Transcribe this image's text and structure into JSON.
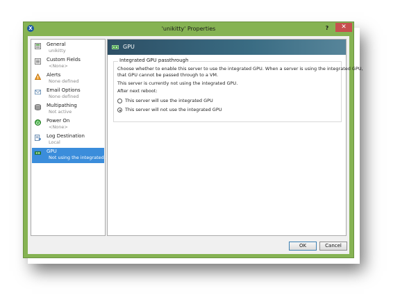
{
  "window": {
    "title": "'unikitty' Properties",
    "help_label": "?",
    "close_label": "✕",
    "app_icon": "xen-logo-icon"
  },
  "sidebar": {
    "items": [
      {
        "label": "General",
        "sub": "unikitty",
        "icon": "general-icon"
      },
      {
        "label": "Custom Fields",
        "sub": "<None>",
        "icon": "custom-fields-icon"
      },
      {
        "label": "Alerts",
        "sub": "None defined",
        "icon": "warning-icon"
      },
      {
        "label": "Email Options",
        "sub": "None defined",
        "icon": "email-icon"
      },
      {
        "label": "Multipathing",
        "sub": "Not active",
        "icon": "disk-icon"
      },
      {
        "label": "Power On",
        "sub": "<None>",
        "icon": "power-icon"
      },
      {
        "label": "Log Destination",
        "sub": "Local",
        "icon": "log-icon"
      },
      {
        "label": "GPU",
        "sub": "Not using the integrated...",
        "icon": "gpu-icon",
        "selected": true
      }
    ]
  },
  "main": {
    "banner_title": "GPU",
    "group_title": "Integrated GPU passthrough",
    "description_line1": "Choose whether to enable this server to use the integrated GPU. When a server is using the integrated GPU,",
    "description_line2": "that GPU cannot be passed through to a VM.",
    "status_text": "This server is currently not using the integrated GPU.",
    "after_reboot_label": "After next reboot:",
    "options": [
      {
        "label": "This server will use the integrated GPU",
        "checked": false
      },
      {
        "label": "This server will not use the integrated GPU",
        "checked": true
      }
    ]
  },
  "buttons": {
    "ok_label": "OK",
    "cancel_label": "Cancel"
  },
  "colors": {
    "window_frame": "#86b353",
    "selection": "#3b8ddb",
    "banner": "#2d4f65",
    "close_button": "#c74f4f"
  }
}
